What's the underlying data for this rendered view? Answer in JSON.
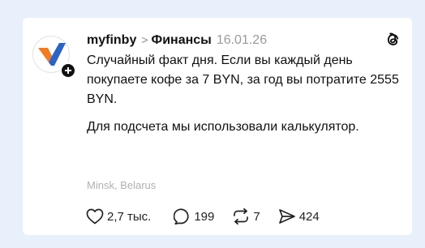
{
  "post": {
    "username": "myfinby",
    "breadcrumb_separator": ">",
    "topic": "Финансы",
    "date": "16.01.26",
    "paragraphs": [
      "Случайный факт дня. Если вы каждый день покупаете кофе за 7 BYN, за год вы потратите 2555 BYN.",
      "Для подсчета мы использовали калькулятор."
    ],
    "location": "Minsk, Belarus"
  },
  "actions": {
    "likes": "2,7 тыс.",
    "comments": "199",
    "reposts": "7",
    "shares": "424"
  },
  "icons": {
    "avatar_logo": "myfin-v-logo-icon",
    "follow": "plus-icon",
    "platform": "threads-icon",
    "like": "heart-icon",
    "comment": "speech-bubble-icon",
    "repost": "repost-arrows-icon",
    "share": "send-icon"
  },
  "colors": {
    "background": "#e8f0fb",
    "card": "#ffffff",
    "logo_orange": "#f47a20",
    "logo_blue": "#2b63c6",
    "text": "#111111",
    "muted": "#9a9a9a"
  }
}
